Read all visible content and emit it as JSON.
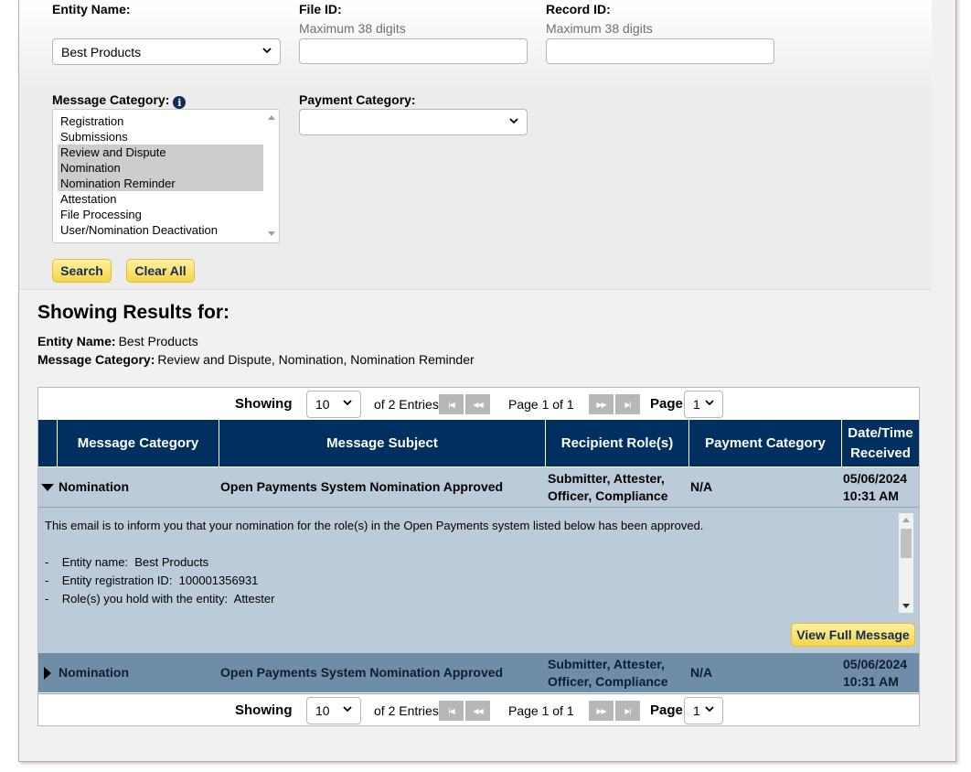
{
  "filters": {
    "entity_name_label": "Entity Name:",
    "entity_name_value": "Best Products",
    "file_id_label": "File ID:",
    "file_id_hint": "Maximum 38 digits",
    "record_id_label": "Record ID:",
    "record_id_hint": "Maximum 38 digits",
    "message_category_label": "Message Category:",
    "payment_category_label": "Payment Category:",
    "payment_category_value": "",
    "message_category_options": [
      {
        "label": "Registration",
        "selected": false
      },
      {
        "label": "Submissions",
        "selected": false
      },
      {
        "label": "Review and Dispute",
        "selected": true
      },
      {
        "label": "Nomination",
        "selected": true
      },
      {
        "label": "Nomination Reminder",
        "selected": true
      },
      {
        "label": "Attestation",
        "selected": false
      },
      {
        "label": "File Processing",
        "selected": false
      },
      {
        "label": "User/Nomination Deactivation",
        "selected": false
      }
    ],
    "search_label": "Search",
    "clear_label": "Clear All"
  },
  "results": {
    "title": "Showing Results for:",
    "entity_label": "Entity Name:",
    "entity_value": "Best Products",
    "category_label": "Message Category:",
    "category_value": "Review and Dispute, Nomination, Nomination Reminder"
  },
  "pager": {
    "showing_label": "Showing",
    "page_size": "10",
    "entries_text": "of 2 Entries",
    "page_text": "Page 1 of 1",
    "page_label": "Page",
    "page_value": "1"
  },
  "table": {
    "columns": [
      "Message Category",
      "Message Subject",
      "Recipient Role(s)",
      "Payment Category",
      "Date/Time Received"
    ],
    "rows": [
      {
        "category": "Nomination",
        "subject": "Open Payments System Nomination Approved",
        "roles_line1": "Submitter, Attester,",
        "roles_line2": "Officer, Compliance",
        "payment": "N/A",
        "date": "05/06/2024",
        "time": "10:31 AM",
        "expanded": true
      },
      {
        "category": "Nomination",
        "subject": "Open Payments System Nomination Approved",
        "roles_line1": "Submitter, Attester,",
        "roles_line2": "Officer, Compliance",
        "payment": "N/A",
        "date": "05/06/2024",
        "time": "10:31 AM",
        "expanded": false
      }
    ],
    "message": {
      "intro": "This email is to inform you that your nomination for the role(s) in the Open Payments system listed below has been approved.",
      "line1": "-    Entity name:  Best Products",
      "line2": "-    Entity registration ID:  100001356931",
      "line3": "-    Role(s) you hold with the entity:  Attester",
      "view_full_label": "View Full Message"
    }
  },
  "colors": {
    "header_navy": "#00305f",
    "row_light": "#bccbd9",
    "row_dark": "#6f8da7",
    "button_yellow": "#f7d547"
  }
}
